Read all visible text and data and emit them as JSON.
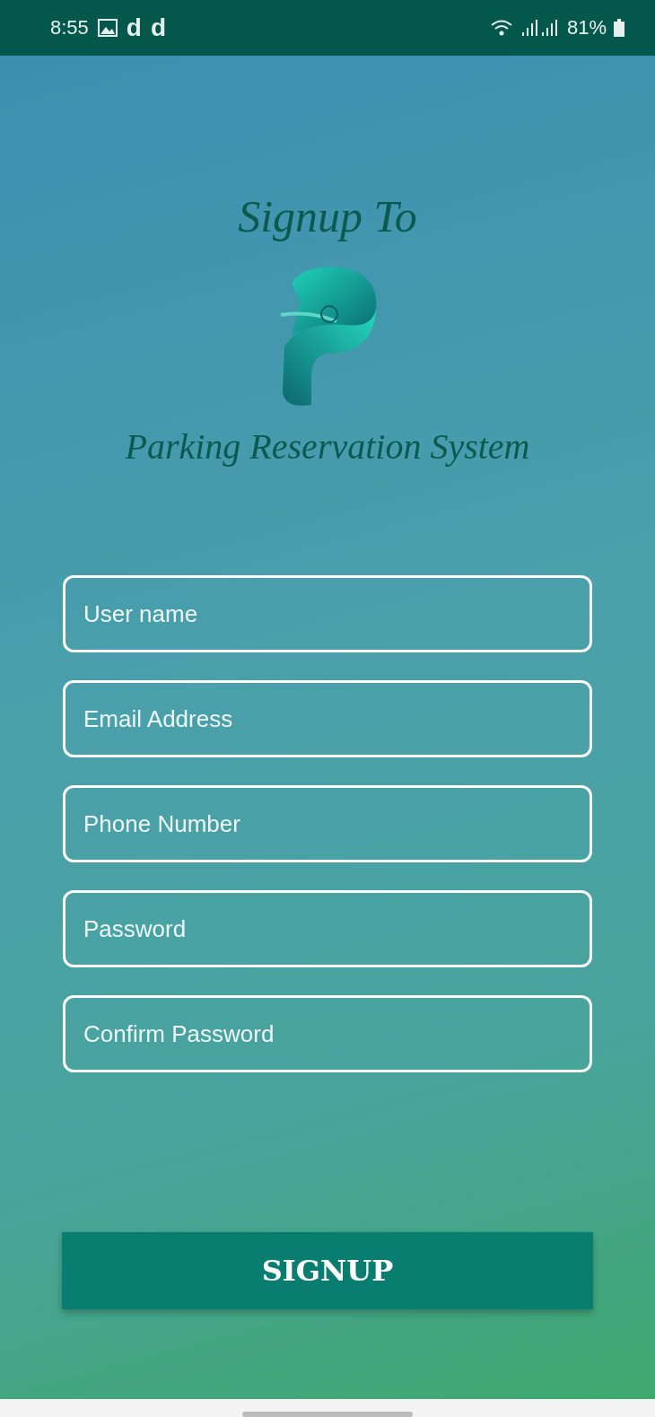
{
  "status_bar": {
    "time": "8:55",
    "notifications": [
      "d",
      "d"
    ],
    "battery": "81%"
  },
  "header": {
    "title": "Signup To",
    "subtitle": "Parking Reservation System"
  },
  "fields": [
    {
      "placeholder": "User name"
    },
    {
      "placeholder": "Email Address"
    },
    {
      "placeholder": "Phone Number"
    },
    {
      "placeholder": "Password"
    },
    {
      "placeholder": "Confirm Password"
    }
  ],
  "submit": {
    "label": "SIGNUP"
  }
}
